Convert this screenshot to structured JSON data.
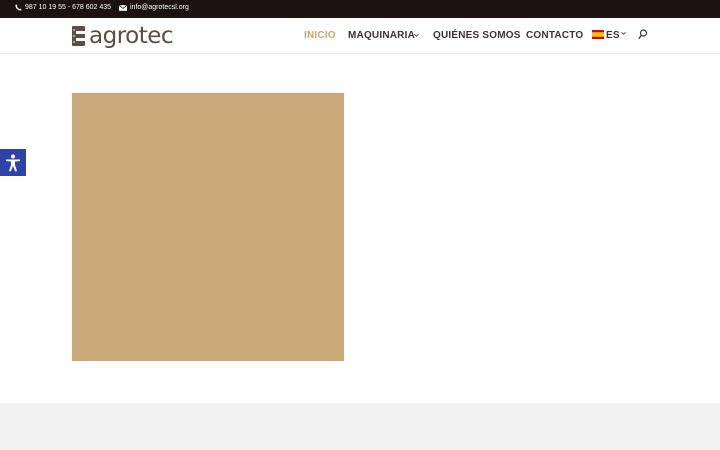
{
  "topbar": {
    "phone": "987 10 19 55 - 678 602 435",
    "email": "info@agrotecsl.org"
  },
  "logo": {
    "text": "agrotec"
  },
  "nav": {
    "items": [
      {
        "label": "INICIO",
        "active": true
      },
      {
        "label": "MAQUINARIA",
        "has_dropdown": true
      },
      {
        "label": "QUIÉNES SOMOS"
      },
      {
        "label": "CONTACTO"
      }
    ],
    "language": {
      "label": "ES",
      "flag": "spain-flag"
    }
  },
  "colors": {
    "topbar_bg": "#1c1211",
    "accent": "#c9a46e",
    "nav_text": "#3b3330",
    "image_placeholder": "#c9a979",
    "accessibility_button": "#2e43a8",
    "footer_bg": "#f2f2f2"
  }
}
